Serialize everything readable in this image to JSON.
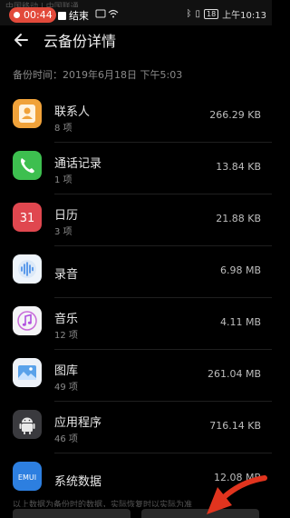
{
  "status_bar": {
    "carrier_text": "中国移动 | 中国联通",
    "record_time": "00:44",
    "stop_label": "结束",
    "battery": "18",
    "clock": "上午10:13"
  },
  "header": {
    "title": "云备份详情"
  },
  "backup_time": "备份时间：2019年6月18日 下午5:03",
  "items": [
    {
      "name": "联系人",
      "count": "8 项",
      "size": "266.29 KB",
      "icon": "contacts-icon"
    },
    {
      "name": "通话记录",
      "count": "1 项",
      "size": "13.84 KB",
      "icon": "phone-icon"
    },
    {
      "name": "日历",
      "count": "3 项",
      "size": "21.88 KB",
      "icon": "calendar-icon",
      "icon_text": "31"
    },
    {
      "name": "录音",
      "count": "",
      "size": "6.98 MB",
      "icon": "recorder-icon"
    },
    {
      "name": "音乐",
      "count": "12 项",
      "size": "4.11 MB",
      "icon": "music-icon"
    },
    {
      "name": "图库",
      "count": "49 项",
      "size": "261.04 MB",
      "icon": "gallery-icon"
    },
    {
      "name": "应用程序",
      "count": "46 项",
      "size": "716.14 KB",
      "icon": "android-icon"
    },
    {
      "name": "系统数据",
      "count": "",
      "size": "12.08 MB",
      "icon": "emui-icon",
      "icon_text": "EMUI"
    }
  ],
  "bottom_note": "以上数据为备份时的数据，实际恢复时以实际为准",
  "colors": {
    "contacts": "#f0a23a",
    "phone": "#3dbf4f",
    "calendar": "#e0474f",
    "recorder": "#eef4fb",
    "music": "#f4f4f6",
    "gallery": "#eef2f8",
    "android": "#3a3a3e",
    "emui": "#2d7fe0",
    "arrow": "#e1341e"
  }
}
